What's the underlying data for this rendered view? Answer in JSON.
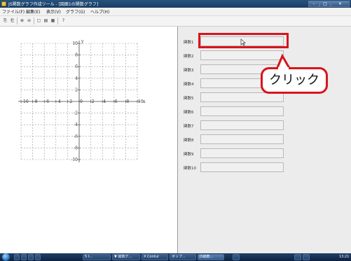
{
  "window": {
    "title": "JS関数グラフ作成ツール - [図面1の関数グラフ]",
    "controls": {
      "minimize": "–",
      "maximize": "□",
      "close": "✕"
    }
  },
  "menu": [
    "ファイル(F)",
    "編集(E)",
    "表示(V)",
    "グラフ(G)",
    "ヘルプ(H)"
  ],
  "toolbar": [
    {
      "icon": "copy-icon",
      "glyph": "⎘"
    },
    {
      "icon": "paste-icon",
      "glyph": "⎗"
    },
    {
      "icon": "zoom-in-icon",
      "glyph": "⊕"
    },
    {
      "icon": "zoom-out-icon",
      "glyph": "⊖"
    },
    {
      "icon": "fit-window-icon",
      "glyph": "▢"
    },
    {
      "icon": "graph-settings-icon",
      "glyph": "▤"
    },
    {
      "icon": "grid-settings-icon",
      "glyph": "▦"
    },
    {
      "icon": "help-icon",
      "glyph": "?"
    }
  ],
  "graph": {
    "x_label": "x",
    "y_label": "y",
    "x_ticks": [
      "-10",
      "-8",
      "-6",
      "-4",
      "-2",
      "0",
      "2",
      "4",
      "6",
      "8",
      "10"
    ],
    "y_ticks": [
      "10",
      "8",
      "6",
      "4",
      "2",
      "-2",
      "-4",
      "-6",
      "-8",
      "-10"
    ],
    "x_range": [
      -10,
      10
    ],
    "y_range": [
      -10,
      10
    ],
    "grid": true
  },
  "formulas": [
    {
      "label": "関数1",
      "value": ""
    },
    {
      "label": "関数2",
      "value": ""
    },
    {
      "label": "関数3",
      "value": ""
    },
    {
      "label": "関数4",
      "value": ""
    },
    {
      "label": "関数5",
      "value": ""
    },
    {
      "label": "関数6",
      "value": ""
    },
    {
      "label": "関数7",
      "value": ""
    },
    {
      "label": "関数8",
      "value": ""
    },
    {
      "label": "関数9",
      "value": ""
    },
    {
      "label": "関数10",
      "value": ""
    }
  ],
  "annotation": {
    "text": "クリック",
    "color": "#d8141c"
  },
  "taskbar": {
    "items": [
      "",
      "",
      "",
      "",
      "5 I...",
      "▼ 関数グ...",
      "X Contur",
      "ポップ...",
      "JS関数...",
      "",
      "",
      ""
    ],
    "clock": "13:21"
  }
}
